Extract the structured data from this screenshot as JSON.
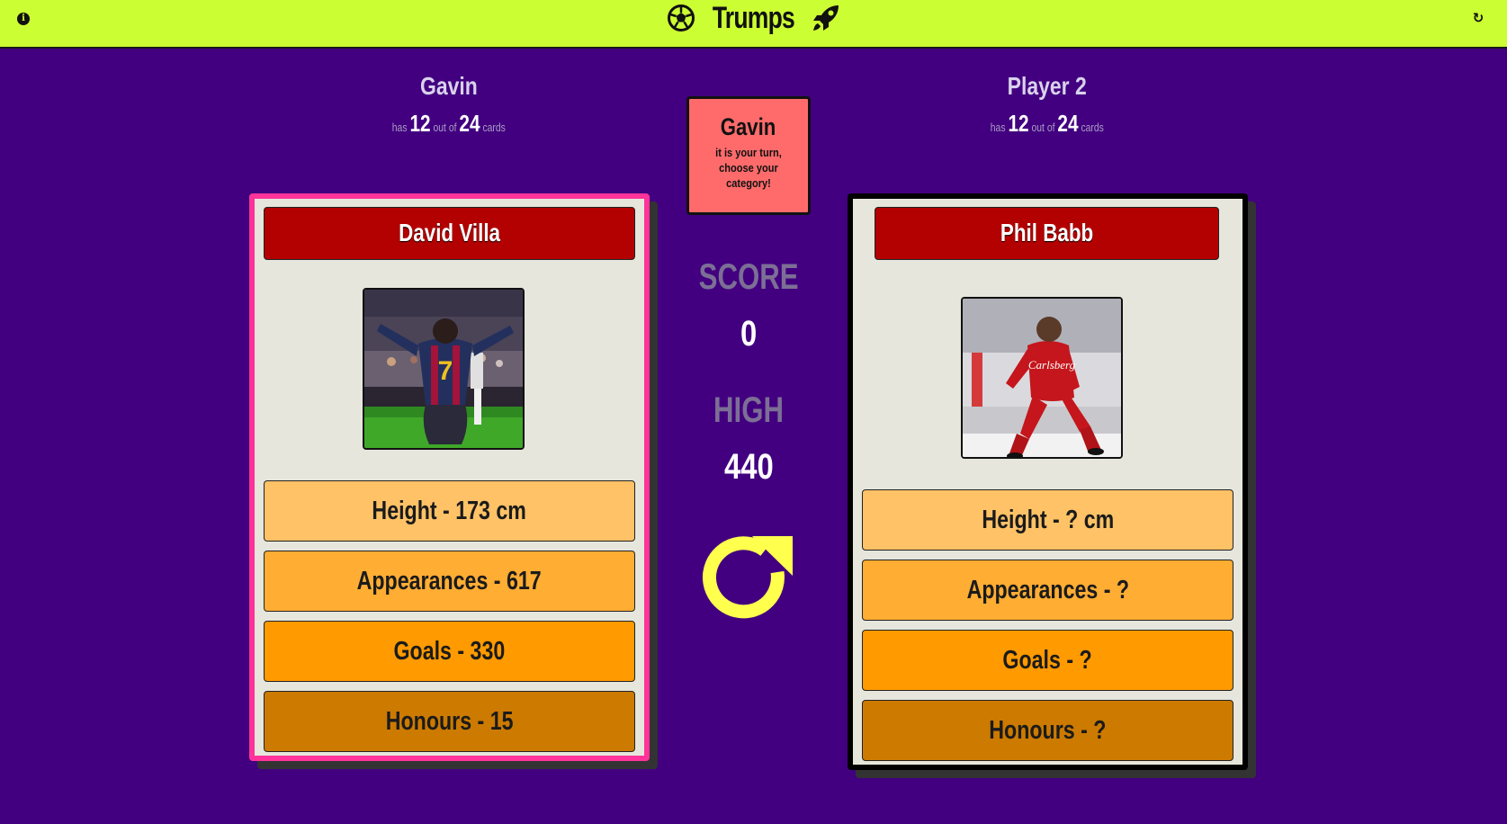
{
  "app": {
    "title": "Trumps"
  },
  "players": [
    {
      "name": "Gavin",
      "has_label": "has",
      "count": "12",
      "outof_label": "out of",
      "total": "24",
      "cards_label": "cards"
    },
    {
      "name": "Player 2",
      "has_label": "has",
      "count": "12",
      "outof_label": "out of",
      "total": "24",
      "cards_label": "cards"
    }
  ],
  "turn": {
    "name": "Gavin",
    "message": "it is your turn, choose your category!"
  },
  "score": {
    "label": "SCORE",
    "value": "0"
  },
  "high": {
    "label": "HIGH",
    "value": "440"
  },
  "cards": [
    {
      "name": "David Villa",
      "stats": [
        "Height - 173 cm",
        "Appearances - 617",
        "Goals - 330",
        "Honours - 15"
      ]
    },
    {
      "name": "Phil Babb",
      "stats": [
        "Height - ? cm",
        "Appearances - ?",
        "Goals - ?",
        "Honours - ?"
      ]
    }
  ],
  "colors": {
    "background": "#420080",
    "topbar": "#ccff33",
    "active_card_border": "#ff3399",
    "turn_box": "#ff6b6b",
    "card_title": "#b30000",
    "next_icon": "#ffff4d"
  },
  "icons": {
    "info": "info-icon",
    "refresh": "refresh-icon",
    "brand_left": "soccer-ball-icon",
    "brand_right": "rocket-icon",
    "next": "redo-arrow-icon"
  }
}
